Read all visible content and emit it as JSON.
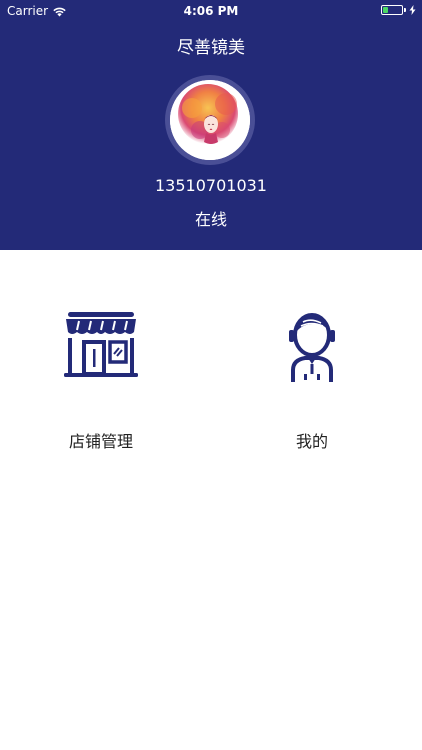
{
  "status_bar": {
    "carrier": "Carrier",
    "time": "4:06 PM"
  },
  "header": {
    "title": "尽善镜美",
    "phone": "13510701031",
    "online_status": "在线",
    "background_color": "#232a78"
  },
  "menu": {
    "items": [
      {
        "label": "店铺管理",
        "icon": "storefront-icon"
      },
      {
        "label": "我的",
        "icon": "user-headset-icon"
      }
    ]
  }
}
